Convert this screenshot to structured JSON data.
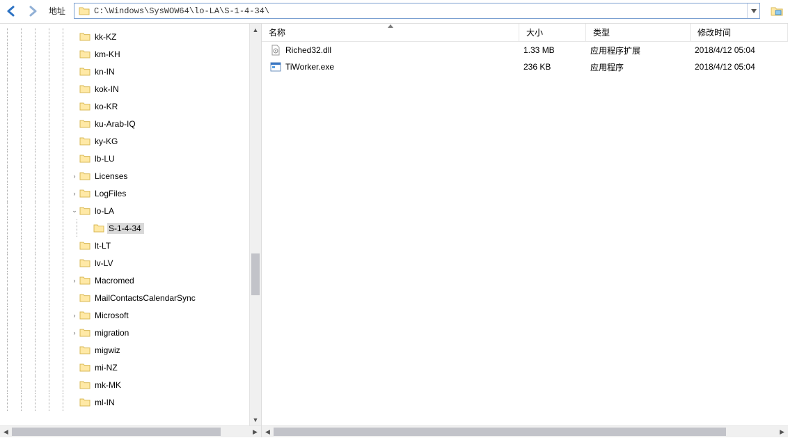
{
  "toolbar": {
    "address_label": "地址",
    "path": "C:\\Windows\\SysWOW64\\lo-LA\\S-1-4-34\\"
  },
  "columns": {
    "name": "名称",
    "size": "大小",
    "type": "类型",
    "date": "修改时间"
  },
  "files": [
    {
      "icon": "dll",
      "name": "Riched32.dll",
      "size": "1.33 MB",
      "type": "应用程序扩展",
      "date": "2018/4/12 05:04"
    },
    {
      "icon": "exe",
      "name": "TiWorker.exe",
      "size": "236 KB",
      "type": "应用程序",
      "date": "2018/4/12 05:04"
    }
  ],
  "tree": [
    {
      "depth": 5,
      "expander": "",
      "label": "kk-KZ"
    },
    {
      "depth": 5,
      "expander": "",
      "label": "km-KH"
    },
    {
      "depth": 5,
      "expander": "",
      "label": "kn-IN"
    },
    {
      "depth": 5,
      "expander": "",
      "label": "kok-IN"
    },
    {
      "depth": 5,
      "expander": "",
      "label": "ko-KR"
    },
    {
      "depth": 5,
      "expander": "",
      "label": "ku-Arab-IQ"
    },
    {
      "depth": 5,
      "expander": "",
      "label": "ky-KG"
    },
    {
      "depth": 5,
      "expander": "",
      "label": "lb-LU"
    },
    {
      "depth": 5,
      "expander": ">",
      "label": "Licenses"
    },
    {
      "depth": 5,
      "expander": ">",
      "label": "LogFiles"
    },
    {
      "depth": 5,
      "expander": "v",
      "label": "lo-LA"
    },
    {
      "depth": 6,
      "expander": "",
      "label": "S-1-4-34",
      "selected": true
    },
    {
      "depth": 5,
      "expander": "",
      "label": "lt-LT"
    },
    {
      "depth": 5,
      "expander": "",
      "label": "lv-LV"
    },
    {
      "depth": 5,
      "expander": ">",
      "label": "Macromed"
    },
    {
      "depth": 5,
      "expander": "",
      "label": "MailContactsCalendarSync"
    },
    {
      "depth": 5,
      "expander": ">",
      "label": "Microsoft"
    },
    {
      "depth": 5,
      "expander": ">",
      "label": "migration"
    },
    {
      "depth": 5,
      "expander": "",
      "label": "migwiz"
    },
    {
      "depth": 5,
      "expander": "",
      "label": "mi-NZ"
    },
    {
      "depth": 5,
      "expander": "",
      "label": "mk-MK"
    },
    {
      "depth": 5,
      "expander": "",
      "label": "ml-IN"
    }
  ]
}
